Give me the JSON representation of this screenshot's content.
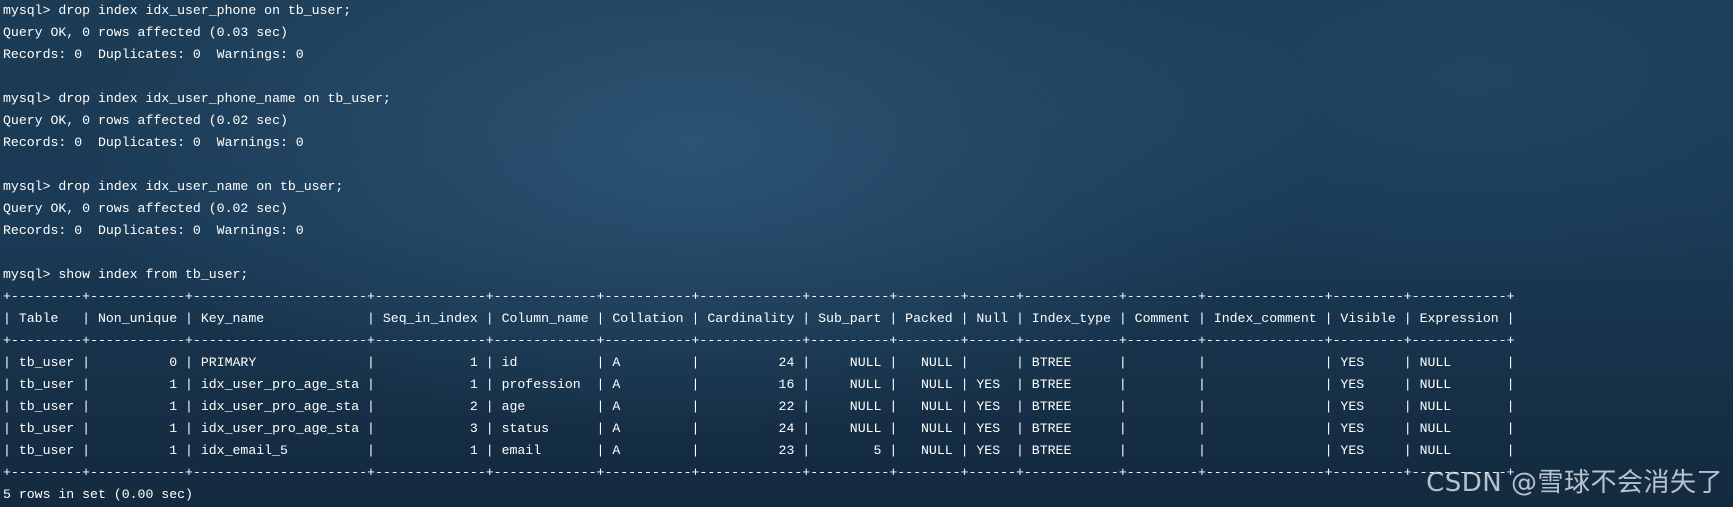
{
  "terminal": {
    "lines": [
      "mysql> drop index idx_user_phone on tb_user;",
      "Query OK, 0 rows affected (0.03 sec)",
      "Records: 0  Duplicates: 0  Warnings: 0",
      "",
      "mysql> drop index idx_user_phone_name on tb_user;",
      "Query OK, 0 rows affected (0.02 sec)",
      "Records: 0  Duplicates: 0  Warnings: 0",
      "",
      "mysql> drop index idx_user_name on tb_user;",
      "Query OK, 0 rows affected (0.02 sec)",
      "Records: 0  Duplicates: 0  Warnings: 0",
      "",
      "mysql> show index from tb_user;",
      "+---------+------------+----------------------+--------------+-------------+-----------+-------------+----------+--------+------+------------+---------+---------------+---------+------------+",
      "| Table   | Non_unique | Key_name             | Seq_in_index | Column_name | Collation | Cardinality | Sub_part | Packed | Null | Index_type | Comment | Index_comment | Visible | Expression |",
      "+---------+------------+----------------------+--------------+-------------+-----------+-------------+----------+--------+------+------------+---------+---------------+---------+------------+",
      "| tb_user |          0 | PRIMARY              |            1 | id          | A         |          24 |     NULL |   NULL |      | BTREE      |         |               | YES     | NULL       |",
      "| tb_user |          1 | idx_user_pro_age_sta |            1 | profession  | A         |          16 |     NULL |   NULL | YES  | BTREE      |         |               | YES     | NULL       |",
      "| tb_user |          1 | idx_user_pro_age_sta |            2 | age         | A         |          22 |     NULL |   NULL | YES  | BTREE      |         |               | YES     | NULL       |",
      "| tb_user |          1 | idx_user_pro_age_sta |            3 | status      | A         |          24 |     NULL |   NULL | YES  | BTREE      |         |               | YES     | NULL       |",
      "| tb_user |          1 | idx_email_5          |            1 | email       | A         |          23 |        5 |   NULL | YES  | BTREE      |         |               | YES     | NULL       |",
      "+---------+------------+----------------------+--------------+-------------+-----------+-------------+----------+--------+------+------------+---------+---------------+---------+------------+",
      "5 rows in set (0.00 sec)"
    ]
  },
  "watermark": {
    "text": "CSDN @雪球不会消失了"
  }
}
